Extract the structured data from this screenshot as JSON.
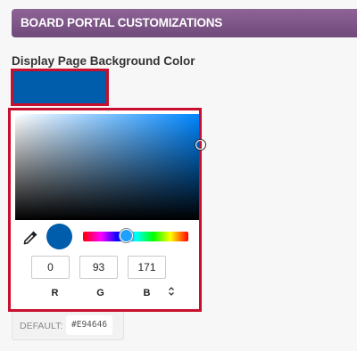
{
  "section": {
    "title": "BOARD PORTAL CUSTOMIZATIONS"
  },
  "field": {
    "label": "Display Page Background Color",
    "current_color": "#005dab"
  },
  "picker": {
    "hue_color": "#0087ff",
    "rgb": {
      "r": {
        "label": "R",
        "value": "0"
      },
      "g": {
        "label": "G",
        "value": "93"
      },
      "b": {
        "label": "B",
        "value": "171"
      }
    },
    "mode_toggle_icon": "updown-chevron-icon",
    "eyedropper_icon": "eyedropper-icon"
  },
  "default": {
    "label": "DEFAULT:",
    "value": "#E94646"
  },
  "colors": {
    "header_start": "#8e6496",
    "header_end": "#6f4a7a",
    "active_border": "#c8102e"
  }
}
